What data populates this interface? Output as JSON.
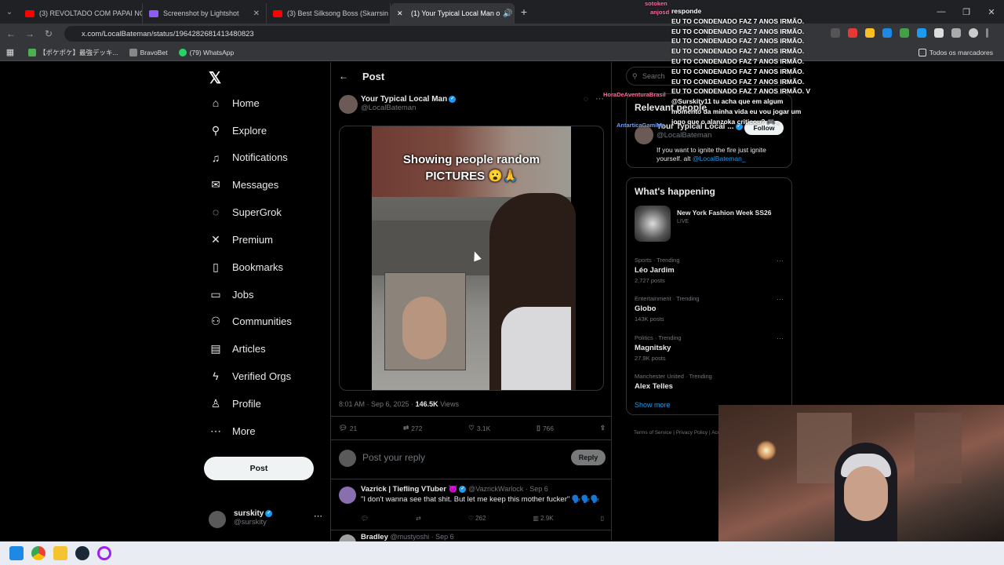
{
  "browser": {
    "tabs": [
      {
        "title": "(3) REVOLTADO COM PAPAI NO",
        "favicon_color": "#ff0000"
      },
      {
        "title": "Screenshot by Lightshot",
        "favicon_color": "#8b5cf6"
      },
      {
        "title": "(3) Best Silksong Boss (Skarrsin",
        "favicon_color": "#ff0000"
      },
      {
        "title": "(1) Your Typical Local Man o",
        "favicon_color": "#ffffff",
        "active": true
      }
    ],
    "url": "x.com/LocalBateman/status/1964282681413480823",
    "bookmarks": [
      "【ポケポケ】最強デッキ...",
      "BravoBet",
      "(79) WhatsApp"
    ],
    "bookmarks_right": "Todos os marcadores"
  },
  "nav": {
    "items": [
      {
        "label": "Home",
        "icon": "home-icon",
        "glyph": "⌂"
      },
      {
        "label": "Explore",
        "icon": "search-icon",
        "glyph": "⚲"
      },
      {
        "label": "Notifications",
        "icon": "bell-icon",
        "glyph": "♫"
      },
      {
        "label": "Messages",
        "icon": "mail-icon",
        "glyph": "✉"
      },
      {
        "label": "SuperGrok",
        "icon": "grok-icon",
        "glyph": "◌"
      },
      {
        "label": "Premium",
        "icon": "x-icon",
        "glyph": "✕"
      },
      {
        "label": "Bookmarks",
        "icon": "bookmark-icon",
        "glyph": "▯"
      },
      {
        "label": "Jobs",
        "icon": "briefcase-icon",
        "glyph": "▭"
      },
      {
        "label": "Communities",
        "icon": "people-icon",
        "glyph": "⚇"
      },
      {
        "label": "Articles",
        "icon": "article-icon",
        "glyph": "▤"
      },
      {
        "label": "Verified Orgs",
        "icon": "lightning-icon",
        "glyph": "ϟ"
      },
      {
        "label": "Profile",
        "icon": "person-icon",
        "glyph": "♙"
      },
      {
        "label": "More",
        "icon": "more-icon",
        "glyph": "⋯"
      }
    ],
    "post_button": "Post",
    "account": {
      "name": "surskity",
      "handle": "@surskity"
    }
  },
  "post": {
    "header": "Post",
    "author_name": "Your Typical Local Man",
    "author_handle": "@LocalBateman",
    "caption": "Showing people random PICTURES 😮🙏",
    "time": "8:01 AM · Sep 6, 2025 · ",
    "views_count": "146.5K",
    "views_label": " Views",
    "replies": "21",
    "reposts": "272",
    "likes": "3.1K",
    "bookmarks": "766",
    "reply_placeholder": "Post your reply",
    "reply_button": "Reply"
  },
  "replies": [
    {
      "name": "Vazrick | Tiefling VTuber 😈",
      "handle": "@VazrickWarlock · Sep 6",
      "text": "\"I don't wanna see that shit. But let me keep this mother fucker\" 🗣️🗣️🗣️",
      "likes": "262",
      "views": "2.9K"
    },
    {
      "name": "Bradley",
      "handle": "@mustyoshi · Sep 6",
      "text": ""
    }
  ],
  "sidebar": {
    "search_placeholder": "Search",
    "relevant_title": "Relevant people",
    "relevant_name": "Your Typical Local ...",
    "relevant_handle": "@LocalBateman",
    "relevant_bio": "If you want to ignite the fire just ignite yourself. alt",
    "relevant_bio_link": "@LocalBateman_",
    "follow_label": "Follow",
    "happening_title": "What's happening",
    "event_title": "New York Fashion Week SS26",
    "event_status": "LIVE",
    "trends": [
      {
        "category": "Sports · Trending",
        "title": "Léo Jardim",
        "count": "2,727 posts"
      },
      {
        "category": "Entertainment · Trending",
        "title": "Globo",
        "count": "143K posts"
      },
      {
        "category": "Politics · Trending",
        "title": "Magnitsky",
        "count": "27.9K posts"
      },
      {
        "category": "Manchester United · Trending",
        "title": "Alex Telles",
        "count": ""
      }
    ],
    "show_more": "Show more",
    "footer": "Terms of Service  |  Privacy Policy  |  Accessibility  |  Ads info  |  More"
  },
  "chat_overlay": {
    "lines": [
      "responde",
      "EU TO CONDENADO FAZ 7 ANOS IRMÃO.",
      "EU TO CONDENADO FAZ 7 ANOS IRMÃO.",
      "EU TO CONDENADO FAZ 7 ANOS IRMÃO.",
      "EU TO CONDENADO FAZ 7 ANOS IRMÃO.",
      "EU TO CONDENADO FAZ 7 ANOS IRMÃO.",
      "EU TO CONDENADO FAZ 7 ANOS IRMÃO.",
      "EU TO CONDENADO FAZ 7 ANOS IRMÃO.",
      "EU TO CONDENADO FAZ 7 ANOS IRMÃO. V",
      "@Surskity11 tu acha que em algum",
      "momento da minha vida eu vou jogar um",
      "jogo que o alanzoka criticou? 🎮 ,"
    ],
    "tags": [
      "sotoken",
      "anjosd",
      "HoraDeAventuraBrasil",
      "AntarticaGaming"
    ]
  },
  "colors": {
    "accent": "#1d9bf0",
    "background": "#000000",
    "border": "#2f3336",
    "muted": "#71767b"
  }
}
